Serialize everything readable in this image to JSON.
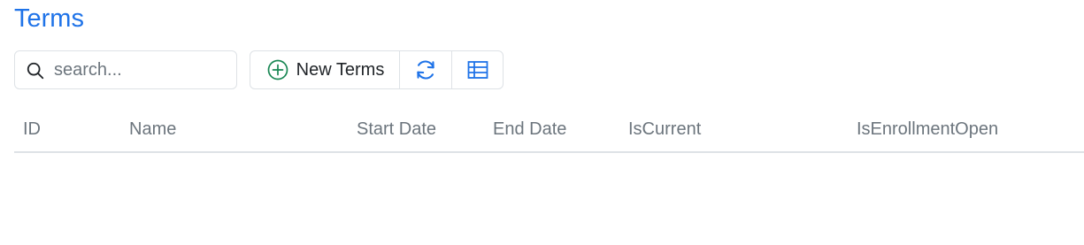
{
  "page": {
    "title": "Terms"
  },
  "search": {
    "placeholder": "search...",
    "value": ""
  },
  "toolbar": {
    "new_label": "New Terms",
    "new_icon": "plus-circle-icon",
    "refresh_icon": "refresh-icon",
    "columns_icon": "table-columns-icon"
  },
  "table": {
    "columns": [
      "ID",
      "Name",
      "Start Date",
      "End Date",
      "IsCurrent",
      "IsEnrollmentOpen"
    ],
    "rows": []
  },
  "colors": {
    "accent": "#1f73e8",
    "success": "#198754",
    "muted_text": "#6c757d",
    "border": "#dee2e6"
  }
}
